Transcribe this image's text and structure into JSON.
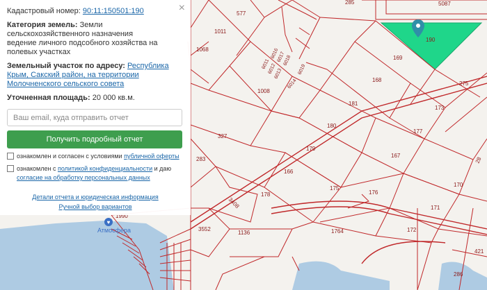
{
  "panel": {
    "close": "×",
    "cadastral_label": "Кадастровый номер:",
    "cadastral_number": "90:11:150501:190",
    "category_label": "Категория земель:",
    "category_value": "Земли сельскохозяйственного назначения",
    "usage_value": "ведение личного подсобного хозяйства на полевых участках",
    "address_label": "Земельный участок по адресу:",
    "address_value": "Республика Крым, Сакский район, на территории Молочненского сельского совета",
    "area_label": "Уточненная площадь:",
    "area_value": "20 000 кв.м.",
    "email_placeholder": "Ваш email, куда отправить отчет",
    "submit_label": "Получить подробный отчет",
    "agree1_text": "ознакомлен и согласен с условиями",
    "agree1_link": "публичной оферты",
    "agree2_text": "ознакомлен с",
    "agree2_link1": "политикой конфиденциальности",
    "agree2_mid": "и даю",
    "agree2_link2": "согласие на обработку персональных данных",
    "details_link": "Детали отчета и юридическая информация",
    "manual_link": "Ручной выбор вариантов"
  },
  "map": {
    "parcels": [
      "577",
      "1011",
      "1068",
      "6016",
      "6017",
      "6018",
      "6011",
      "6012",
      "6013",
      "6019",
      "6014",
      "1008",
      "169",
      "168",
      "275",
      "181",
      "173",
      "180",
      "177",
      "327",
      "179",
      "167",
      "283",
      "166",
      "175",
      "176",
      "170",
      "3408",
      "178",
      "171",
      "3552",
      "1136",
      "1764",
      "172",
      "286",
      "421",
      "1990",
      "5087",
      "285",
      "190",
      "28"
    ],
    "poi": "Атмосфера",
    "highlight_color": "#1fd68a",
    "marker_color": "#2f8fa8",
    "sea_color": "#aecbe3"
  }
}
